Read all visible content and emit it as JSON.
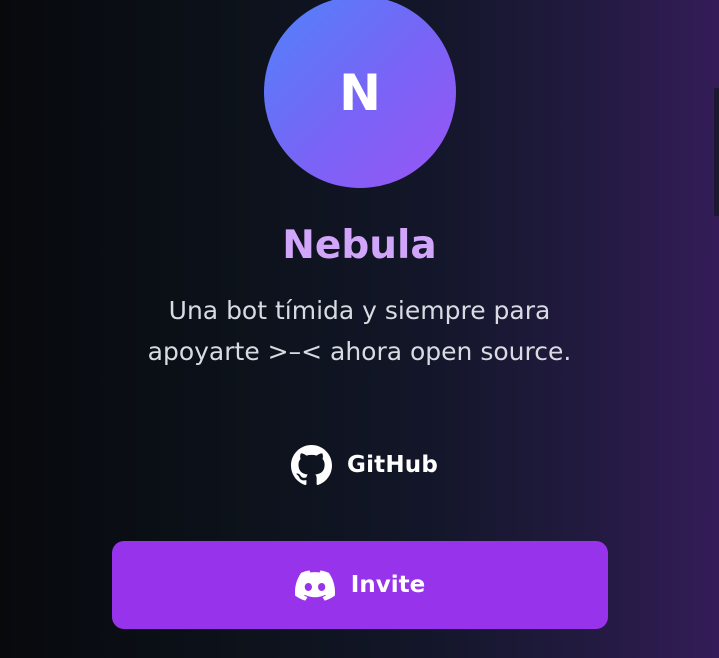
{
  "profile": {
    "avatar_letter": "N",
    "name": "Nebula",
    "description": "Una bot tímida y siempre para apoyarte >–< ahora open source."
  },
  "links": {
    "github_label": "GitHub",
    "github_icon": "github-icon"
  },
  "invite": {
    "label": "Invite",
    "icon": "discord-icon"
  },
  "colors": {
    "title": "#d1a6fa",
    "button": "#9733ea",
    "avatar_start": "#4f83fa",
    "avatar_end": "#9a55f4",
    "text": "#d9dbe2"
  }
}
